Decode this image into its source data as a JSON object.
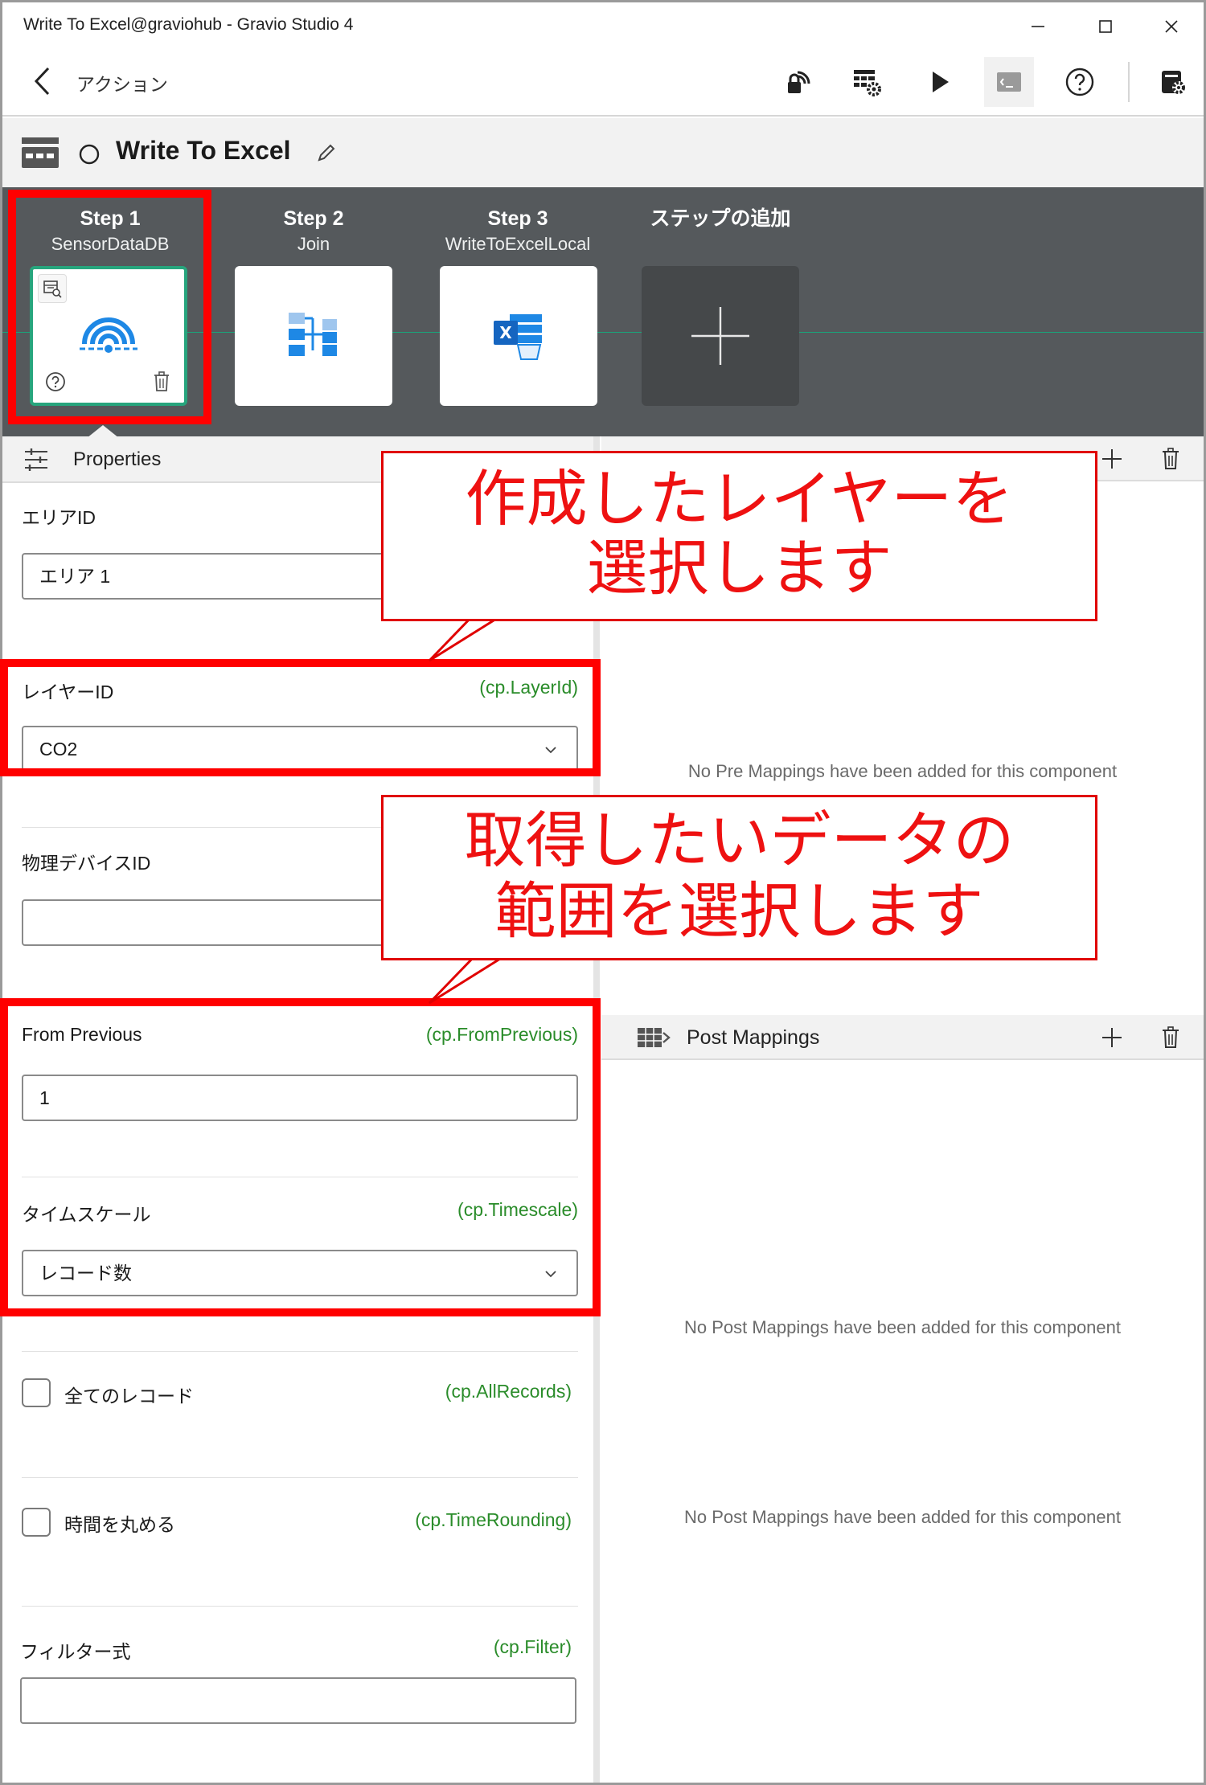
{
  "window": {
    "title": "Write To Excel@graviohub - Gravio Studio 4"
  },
  "appbar": {
    "back_label": "アクション"
  },
  "action": {
    "name": "Write To Excel"
  },
  "steps": [
    {
      "title": "Step 1",
      "subtitle": "SensorDataDB"
    },
    {
      "title": "Step 2",
      "subtitle": "Join"
    },
    {
      "title": "Step 3",
      "subtitle": "WriteToExcelLocal"
    },
    {
      "title": "ステップの追加",
      "subtitle": ""
    }
  ],
  "properties": {
    "header": "Properties",
    "area": {
      "label": "エリアID",
      "value": "エリア 1"
    },
    "layer": {
      "label": "レイヤーID",
      "cp": "(cp.LayerId)",
      "value": "CO2"
    },
    "device": {
      "label": "物理デバイスID",
      "value": ""
    },
    "from_previous": {
      "label": "From Previous",
      "cp": "(cp.FromPrevious)",
      "value": "1"
    },
    "timescale": {
      "label": "タイムスケール",
      "cp": "(cp.Timescale)",
      "value": "レコード数"
    },
    "all_records": {
      "label": "全てのレコード",
      "cp": "(cp.AllRecords)"
    },
    "time_rounding": {
      "label": "時間を丸める",
      "cp": "(cp.TimeRounding)"
    },
    "filter": {
      "label": "フィルター式",
      "cp": "(cp.Filter)",
      "value": ""
    }
  },
  "mappings": {
    "pre_empty": "No Pre Mappings have been added for this component",
    "post_header": "Post Mappings",
    "post_empty": "No Post Mappings have been added for this component",
    "post_empty_2": "No Post Mappings have been added for this component"
  },
  "annotations": {
    "callout1": [
      "作成したレイヤーを",
      "選択します"
    ],
    "callout2": [
      "取得したいデータの",
      "範囲を選択します"
    ]
  },
  "colors": {
    "annotation_red": "#ff0000",
    "steps_bg": "#55595c",
    "accent_green": "#27a57d",
    "cp_green": "#2a8c2a",
    "icon_blue": "#1e88e5"
  }
}
